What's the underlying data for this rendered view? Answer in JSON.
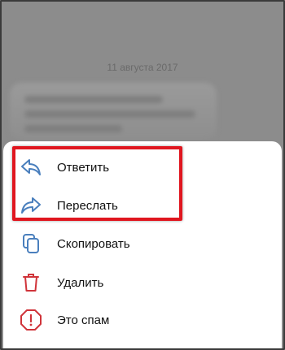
{
  "chat": {
    "date_label": "11 августа 2017"
  },
  "menu": {
    "items": [
      {
        "label": "Ответить",
        "icon": "reply-icon",
        "color": "#4a7fbd"
      },
      {
        "label": "Переслать",
        "icon": "forward-icon",
        "color": "#4a7fbd"
      },
      {
        "label": "Скопировать",
        "icon": "copy-icon",
        "color": "#4a7fbd"
      },
      {
        "label": "Удалить",
        "icon": "trash-icon",
        "color": "#d0343a"
      },
      {
        "label": "Это спам",
        "icon": "spam-warning-icon",
        "color": "#d0343a"
      }
    ]
  },
  "annotation": {
    "highlight_color": "#e0161f"
  }
}
